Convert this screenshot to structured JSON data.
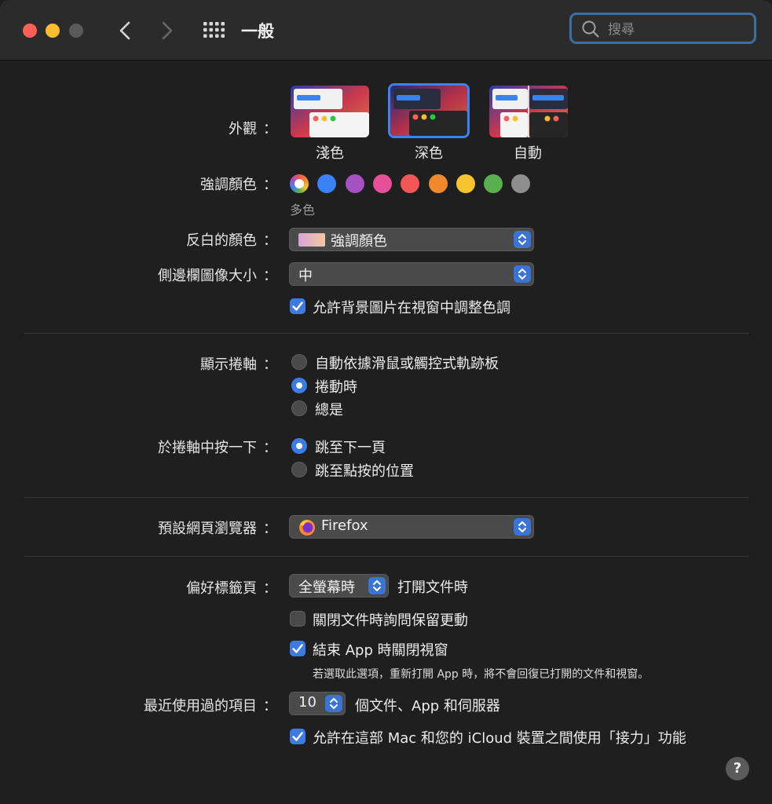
{
  "window": {
    "title": "一般"
  },
  "search": {
    "placeholder": "搜尋"
  },
  "appearance": {
    "label": "外觀",
    "options": [
      {
        "label": "淺色"
      },
      {
        "label": "深色",
        "selected": true
      },
      {
        "label": "自動"
      }
    ]
  },
  "accent": {
    "label": "強調顏色",
    "caption": "多色",
    "colors": [
      "multicolor",
      "#3b82f6",
      "#a551c2",
      "#e6509a",
      "#f25555",
      "#f0892c",
      "#f7c430",
      "#5ab04f",
      "#8e8e8e"
    ]
  },
  "highlight": {
    "label": "反白的顏色",
    "value": "強調顏色"
  },
  "sidebar_icon": {
    "label": "側邊欄圖像大小",
    "value": "中"
  },
  "wallpaper_tint": {
    "label": "允許背景圖片在視窗中調整色調",
    "checked": true
  },
  "scrollbars": {
    "label": "顯示捲軸",
    "options": [
      {
        "label": "自動依據滑鼠或觸控式軌跡板",
        "selected": false
      },
      {
        "label": "捲動時",
        "selected": true
      },
      {
        "label": "總是",
        "selected": false
      }
    ]
  },
  "scroll_click": {
    "label": "於捲軸中按一下",
    "options": [
      {
        "label": "跳至下一頁",
        "selected": true
      },
      {
        "label": "跳至點按的位置",
        "selected": false
      }
    ]
  },
  "browser": {
    "label": "預設網頁瀏覽器",
    "value": "Firefox"
  },
  "tabs": {
    "label": "偏好標籤頁",
    "value": "全螢幕時",
    "suffix": "打開文件時"
  },
  "ask_keep": {
    "label": "關閉文件時詢問保留更動",
    "checked": false
  },
  "close_windows": {
    "label": "結束 App 時關閉視窗",
    "checked": true,
    "note": "若選取此選項，重新打開 App 時，將不會回復已打開的文件和視窗。"
  },
  "recent": {
    "label": "最近使用過的項目",
    "value": "10",
    "suffix": "個文件、App 和伺服器"
  },
  "handoff": {
    "label": "允許在這部 Mac 和您的 iCloud 裝置之間使用「接力」功能",
    "checked": true
  },
  "help": {
    "label": "?"
  },
  "colon": "："
}
